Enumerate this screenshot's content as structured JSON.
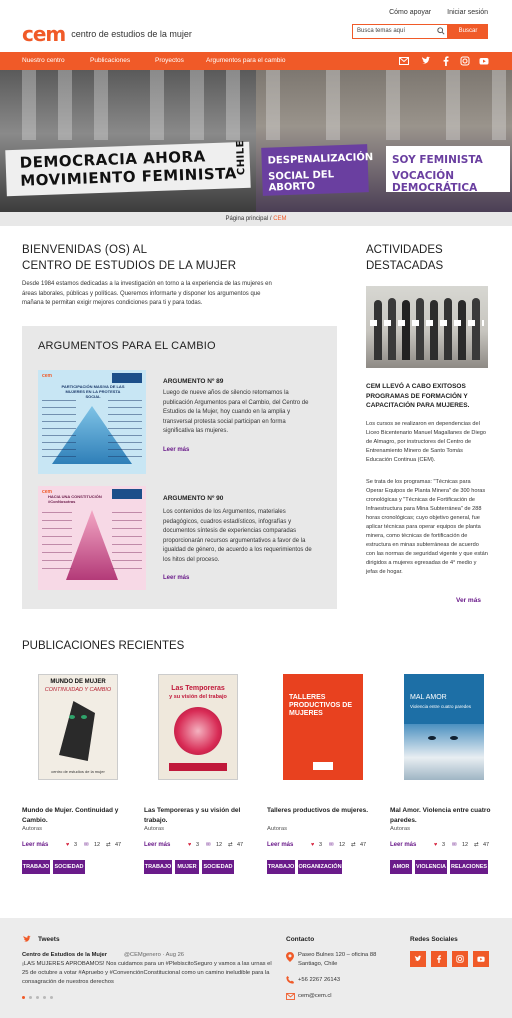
{
  "header": {
    "logo_mark": "cem",
    "logo_text": "centro de estudios de la mujer",
    "links": [
      "Cómo apoyar",
      "Iniciar sesión"
    ],
    "search_placeholder": "Busca temas aquí",
    "search_button": "Buscar"
  },
  "nav": {
    "items": [
      "Nuestro centro",
      "Publicaciones",
      "Proyectos",
      "Argumentos para el cambio"
    ],
    "social_icons": [
      "mail-icon",
      "twitter-icon",
      "facebook-icon",
      "instagram-icon",
      "youtube-icon"
    ]
  },
  "hero": {
    "banner_left_line1": "DEMOCRACIA AHORA",
    "banner_left_line2": "MOVIMIENTO FEMINISTA",
    "banner_left_side": "CHILE",
    "banner_mid_line1": "DESPENALIZACIÓN",
    "banner_mid_line2": "SOCIAL DEL ABORTO",
    "banner_right_line1": "SOY FEMINISTA",
    "banner_right_line2": "VOCACIÓN DEMOCRÁTICA"
  },
  "breadcrumb": {
    "home": "Página principal",
    "sep": " / ",
    "current": "CEM"
  },
  "welcome": {
    "title_line1": "BIENVENIDAS (OS) AL",
    "title_line2": "CENTRO DE ESTUDIOS DE LA MUJER",
    "text": "Desde 1984 estamos dedicadas a la investigación en torno a la experiencia de las mujeres en áreas laborales, públicas y políticas. Queremos informarte y disponer los argumentos que mañana te permitan exigir mejores condiciones para ti y para todas."
  },
  "args": {
    "title": "ARGUMENTOS PARA EL CAMBIO",
    "items": [
      {
        "heading": "ARGUMENTO Nº 89",
        "text": "Luego de nueve años de silencio retomamos la publicación Argumentos para el Cambio, del Centro de Estudios de la Mujer, hoy cuando en la amplia y transversal protesta social participan en forma significativa las mujeres.",
        "more": "Leer más",
        "thumb_title": "PARTICIPACIÓN MASIVA DE LAS MUJERES EN LA PROTESTA SOCIAL"
      },
      {
        "heading": "ARGUMENTO Nº 90",
        "text": "Los contenidos de los Argumentos, materiales pedagógicos, cuadros estadísticos, infografías y documentos síntesis de experiencias comparadas proporcionarán recursos argumentativos a favor de la igualdad de género, de acuerdo a los requerimientos de los hitos del proceso.",
        "more": "Leer más",
        "thumb_title": "HACIA UNA CONSTITUCIÓN #ConNosotras"
      }
    ]
  },
  "activities": {
    "title_line1": "ACTIVIDADES",
    "title_line2": "DESTACADAS",
    "heading": "CEM LLEVÓ A CABO EXITOSOS PROGRAMAS DE FORMACIÓN Y CAPACITACIÓN PARA MUJERES.",
    "p1": "Los cursos se realizaron en dependencias del Liceo Bicentenario Manuel Magallanes de Diego de Almagro, por instructores del Centro de Entrenamiento Minero de Santo Tomás Educación Continua (CEM).",
    "p2": "Se trata de los programas: \"Técnicas para Operar Equipos de Planta Minera\" de 300 horas cronológicas y \"Técnicas de Fortificación de Infraestructura para Mina Subterránea\" de 288 horas cronológicas; cuyo objetivo general, fue aplicar técnicas para operar equipos de planta minera, como técnicas de fortificación de estructura en minas subterráneas de acuerdo con las normas de seguridad vigente y que están dirigidos a mujeres egresadas de 4° medio y jefas de hogar.",
    "more": "Ver más"
  },
  "publications": {
    "title": "PUBLICACIONES RECIENTES",
    "items": [
      {
        "title": "Mundo de Mujer. Continuidad y Cambio.",
        "author": "Autoras",
        "more": "Leer más",
        "likes": "3",
        "comments": "12",
        "shares": "47",
        "tags": [
          "TRABAJO",
          "SOCIEDAD"
        ],
        "cover_l1": "MUNDO DE MUJER",
        "cover_l2": "CONTINUIDAD Y CAMBIO",
        "cover_l3": "centro de estudios de la mujer"
      },
      {
        "title": "Las Temporeras y su visión del trabajo.",
        "author": "Autoras",
        "more": "Leer más",
        "likes": "3",
        "comments": "12",
        "shares": "47",
        "tags": [
          "TRABAJO",
          "MUJER",
          "SOCIEDAD"
        ],
        "cover_l1": "Las Temporeras",
        "cover_l2": "y su visión del trabajo"
      },
      {
        "title": "Talleres productivos de mujeres.",
        "author": "Autoras",
        "more": "Leer más",
        "likes": "3",
        "comments": "12",
        "shares": "47",
        "tags": [
          "TRABAJO",
          "ORGANIZACIÓN"
        ],
        "cover_l1": "TALLERES PRODUCTIVOS DE MUJERES"
      },
      {
        "title": "Mal Amor. Violencia entre cuatro paredes.",
        "author": "Autoras",
        "more": "Leer más",
        "likes": "3",
        "comments": "12",
        "shares": "47",
        "tags": [
          "AMOR",
          "VIOLENCIA",
          "RELACIONES"
        ],
        "cover_l1": "MAL AMOR",
        "cover_l2": "Violencia entre cuatro paredes"
      }
    ]
  },
  "footer": {
    "tweets_label": "Tweets",
    "tweet_user": "Centro de Estudios de la Mujer",
    "tweet_meta": "@CEMgenero · Aug 26",
    "tweet_text": "¡LAS MUJERES APROBAMOS! Nos cuidamos para un #PlebiscitoSeguro y vamos a las urnas el 25 de octubre a votar #Apruebo y #ConvenciónConstitucional como un camino ineludible para la consagración de nuestros derechos",
    "contact_label": "Contacto",
    "address_line1": "Paseo Bulnes 120 – oficina 88",
    "address_line2": "Santiago, Chile",
    "phone": "+56 2267 26143",
    "email": "cem@cem.cl",
    "social_label": "Redes Sociales"
  },
  "colors": {
    "accent": "#f05a28",
    "purple": "#6a1b8a"
  }
}
